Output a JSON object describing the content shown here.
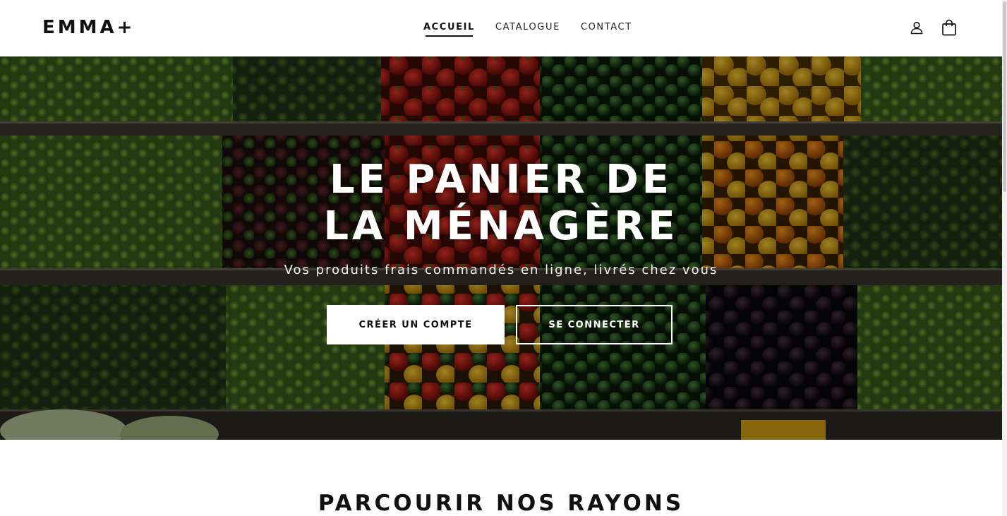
{
  "header": {
    "logo": "EMMA+",
    "nav": [
      {
        "label": "ACCUEIL",
        "active": true
      },
      {
        "label": "CATALOGUE",
        "active": false
      },
      {
        "label": "CONTACT",
        "active": false
      }
    ],
    "icons": [
      "user-icon",
      "shopping-bag-icon"
    ]
  },
  "hero": {
    "title": "LE PANIER DE LA MÉNAGÈRE",
    "subtitle": "Vos produits frais commandés en ligne, livrés chez vous",
    "primary_button": "CRÉER UN COMPTE",
    "secondary_button": "SE CONNECTER"
  },
  "section": {
    "title": "PARCOURIR NOS RAYONS"
  }
}
